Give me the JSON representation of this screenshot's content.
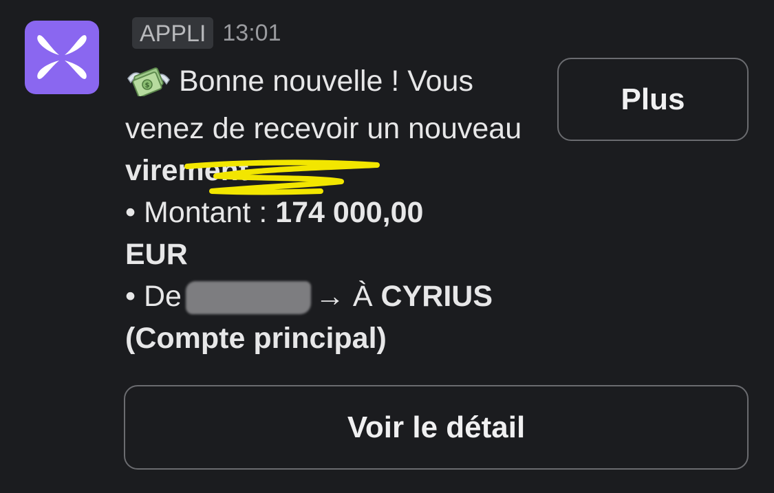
{
  "notification": {
    "app_badge": "APPLI",
    "time": "13:01",
    "emoji_icon": "money-with-wings-icon",
    "message": {
      "intro_before": "Bonne nouvelle ! Vous venez de recevoir un nouveau ",
      "intro_bold": "virement",
      "intro_after": ".",
      "amount_prefix": "• Montant : ",
      "amount_value": "174 000,00",
      "currency": "EUR",
      "from_prefix": "• De",
      "to_arrow": "→ À ",
      "to_name": "CYRIUS",
      "to_account": "(Compte principal)"
    },
    "buttons": {
      "more_label": "Plus",
      "detail_label": "Voir le détail"
    }
  },
  "colors": {
    "background": "#1b1c1f",
    "app_icon": "#8a67f0",
    "highlight": "#f2e600",
    "button_border": "#6b6c70"
  }
}
